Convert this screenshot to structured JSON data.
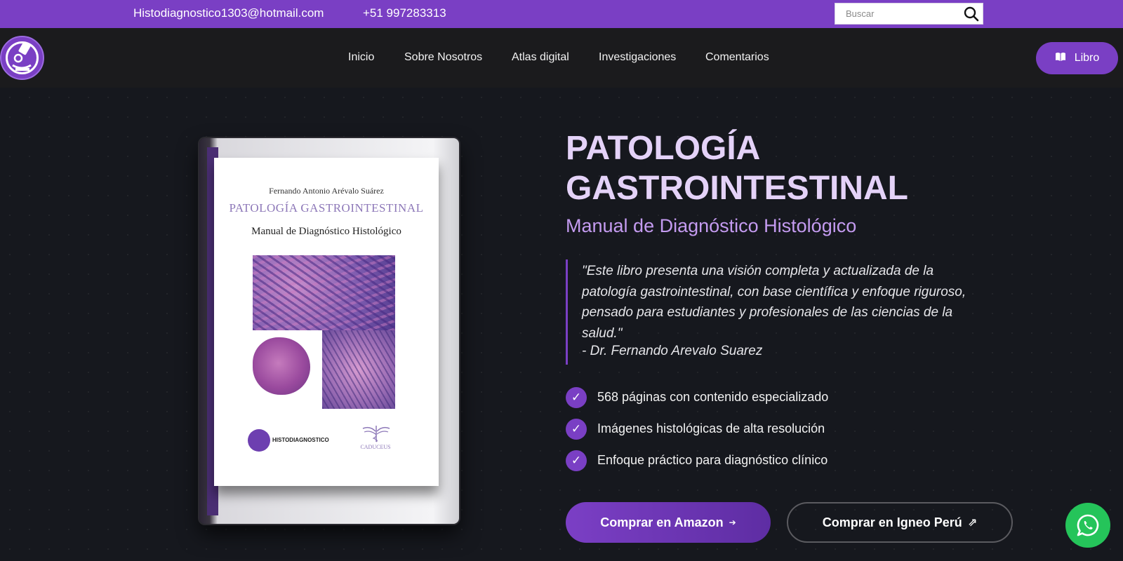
{
  "topbar": {
    "email": "Histodiagnostico1303@hotmail.com",
    "phone": "+51 997283313",
    "search_placeholder": "Buscar",
    "search_icon": "search-icon"
  },
  "nav": {
    "logo_icon": "microscope-logo-icon",
    "items": [
      {
        "label": "Inicio"
      },
      {
        "label": "Sobre Nosotros"
      },
      {
        "label": "Atlas digital"
      },
      {
        "label": "Investigaciones"
      },
      {
        "label": "Comentarios"
      }
    ],
    "cta_label": "Libro",
    "cta_icon": "book-open-icon"
  },
  "book": {
    "author": "Fernando Antonio Arévalo Suárez",
    "title": "PATOLOGÍA GASTROINTESTINAL",
    "subtitle": "Manual de Diagnóstico Histológico",
    "brand": "HISTODIAGNOSTICO",
    "publisher": "CADUCEUS"
  },
  "hero": {
    "title": "PATOLOGÍA GASTROINTESTINAL",
    "subtitle": "Manual de Diagnóstico Histológico",
    "quote": "\"Este libro presenta una visión completa y actualizada de la patología gastrointestinal, con base científica y enfoque riguroso, pensado para estudiantes y profesionales de las ciencias de la salud.\"",
    "quote_author": "- Dr. Fernando Arevalo Suarez",
    "features": [
      {
        "text": "568 páginas con contenido especializado"
      },
      {
        "text": "Imágenes histológicas de alta resolución"
      },
      {
        "text": "Enfoque práctico para diagnóstico clínico"
      }
    ],
    "check_glyph": "✓",
    "btn_amazon": "Comprar en Amazon",
    "btn_amazon_arrow": "➔",
    "btn_igneo": "Comprar en Igneo Perú",
    "btn_igneo_arrow": "⇗"
  },
  "whatsapp_icon": "whatsapp-icon",
  "colors": {
    "accent": "#7a3fc4",
    "background": "#16181e",
    "navbar": "#1b1b1d",
    "title": "#e4d2f8",
    "subtitle": "#c49bf0",
    "whatsapp": "#25c45a"
  }
}
